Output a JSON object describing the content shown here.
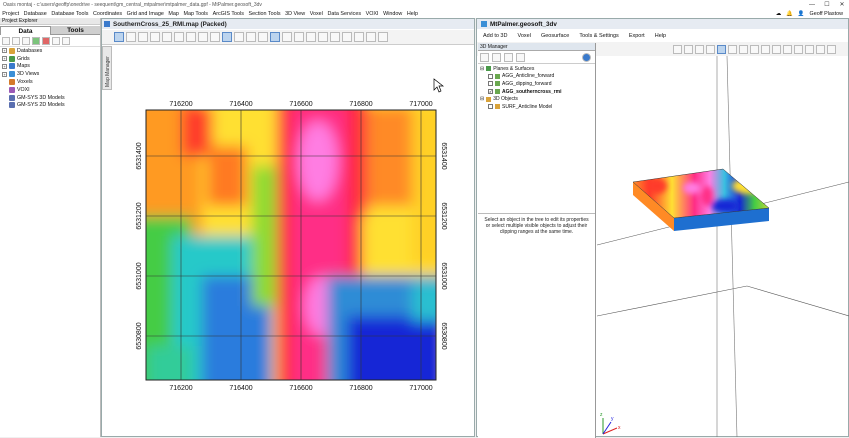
{
  "titlebar": {
    "title": "Oasis montaj - c:\\users\\geoffp\\onedrive - seequent\\gm_central_mtpalmer\\mtpalmer_data.gpf - MtPalmer.geosoft_3dv",
    "controls": [
      "—",
      "☐",
      "✕"
    ]
  },
  "menubar": {
    "items": [
      "Project",
      "Database",
      "Database Tools",
      "Coordinates",
      "Grid and Image",
      "Map",
      "Map Tools",
      "ArcGIS Tools",
      "Section Tools",
      "3D View",
      "Voxel",
      "Data Services",
      "VOXI",
      "Window",
      "Help"
    ],
    "user": "Geoff Plastow"
  },
  "explorer": {
    "title": "Project Explorer",
    "tabs": [
      "Data",
      "Tools"
    ],
    "items": [
      {
        "label": "Databases",
        "color": "#d9a33a"
      },
      {
        "label": "Grids",
        "color": "#4a9a4a"
      },
      {
        "label": "Maps",
        "color": "#3a7acc"
      },
      {
        "label": "3D Views",
        "color": "#3b8fd6"
      },
      {
        "label": "Voxels",
        "color": "#d47a2a"
      },
      {
        "label": "VOXI",
        "color": "#9b59b6"
      },
      {
        "label": "GM-SYS 3D Models",
        "color": "#5a6fb0"
      },
      {
        "label": "GM-SYS 2D Models",
        "color": "#5a6fb0"
      }
    ]
  },
  "mapwin": {
    "title": "SouthernCross_25_RMI.map (Packed)",
    "side_tab": "Map Manager",
    "x_ticks": [
      "716200",
      "716400",
      "716600",
      "716800",
      "717000"
    ],
    "y_ticks": [
      "6531400",
      "6531200",
      "6531000",
      "6530800"
    ]
  },
  "v3d": {
    "title": "MtPalmer.geosoft_3dv",
    "menu": [
      "Add to 3D",
      "Voxel",
      "Geosurface",
      "Tools & Settings",
      "Export",
      "Help"
    ],
    "manager": {
      "title": "3D Manager",
      "groups": [
        {
          "label": "Planes & Surfaces",
          "children": [
            {
              "label": "AGG_Anticline_forward",
              "checked": false,
              "bold": false
            },
            {
              "label": "AGG_dipping_forward",
              "checked": false,
              "bold": false
            },
            {
              "label": "AGG_southerncross_rmi",
              "checked": true,
              "bold": true
            }
          ]
        },
        {
          "label": "3D Objects",
          "children": [
            {
              "label": "SURF_Anticline Model",
              "checked": false,
              "bold": false
            }
          ]
        }
      ],
      "hint": "Select an object in the tree to edit its properties or select multiple visible objects to adjust their clipping ranges at the same time."
    }
  },
  "axes": {
    "x": "x",
    "y": "y",
    "z": "z"
  }
}
